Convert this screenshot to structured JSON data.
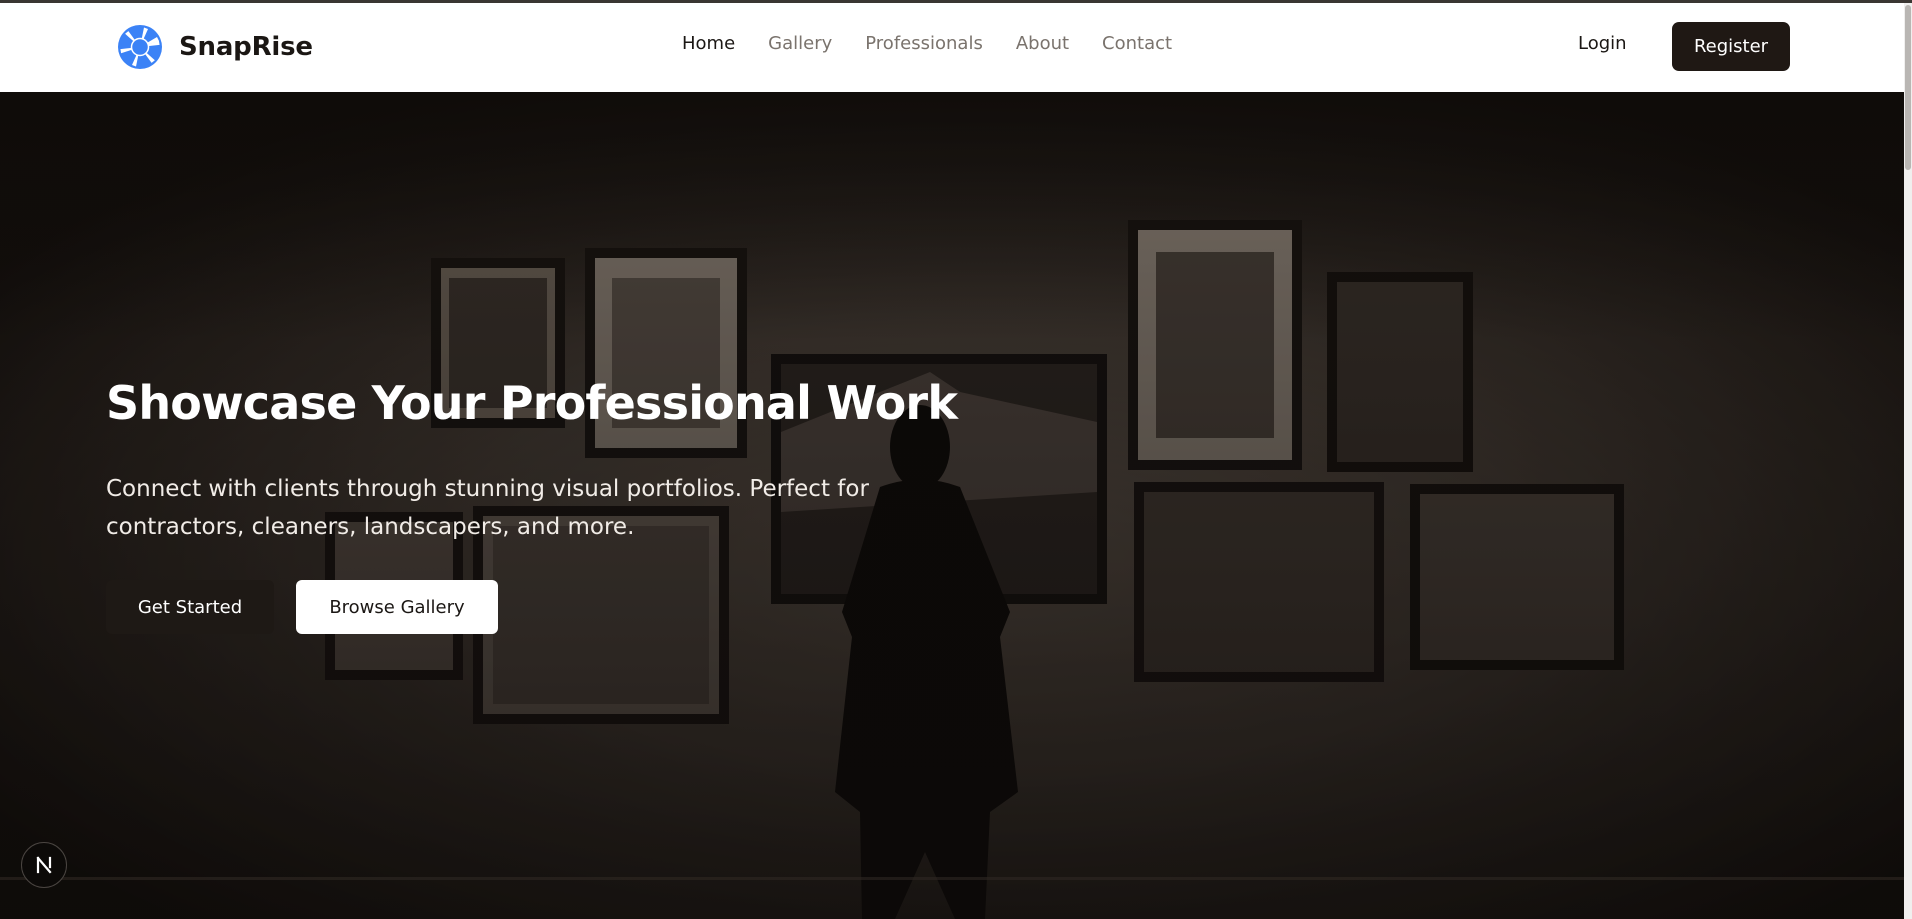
{
  "brand": {
    "name": "SnapRise",
    "logo_icon": "camera-aperture-icon",
    "logo_color": "#3b82f6"
  },
  "nav": {
    "links": [
      {
        "label": "Home",
        "active": true
      },
      {
        "label": "Gallery",
        "active": false
      },
      {
        "label": "Professionals",
        "active": false
      },
      {
        "label": "About",
        "active": false
      },
      {
        "label": "Contact",
        "active": false
      }
    ],
    "login_label": "Login",
    "register_label": "Register"
  },
  "hero": {
    "title": "Showcase Your Professional Work",
    "subtitle": "Connect with clients through stunning visual portfolios. Perfect for contractors, cleaners, landscapers, and more.",
    "primary_button": "Get Started",
    "secondary_button": "Browse Gallery",
    "background_image": "art-gallery-visitor-silhouette"
  },
  "dev_badge": {
    "icon": "nextjs-n-icon"
  },
  "colors": {
    "dark": "#1f1814",
    "white": "#ffffff",
    "muted_nav": "#7a736d",
    "accent": "#3b82f6"
  }
}
